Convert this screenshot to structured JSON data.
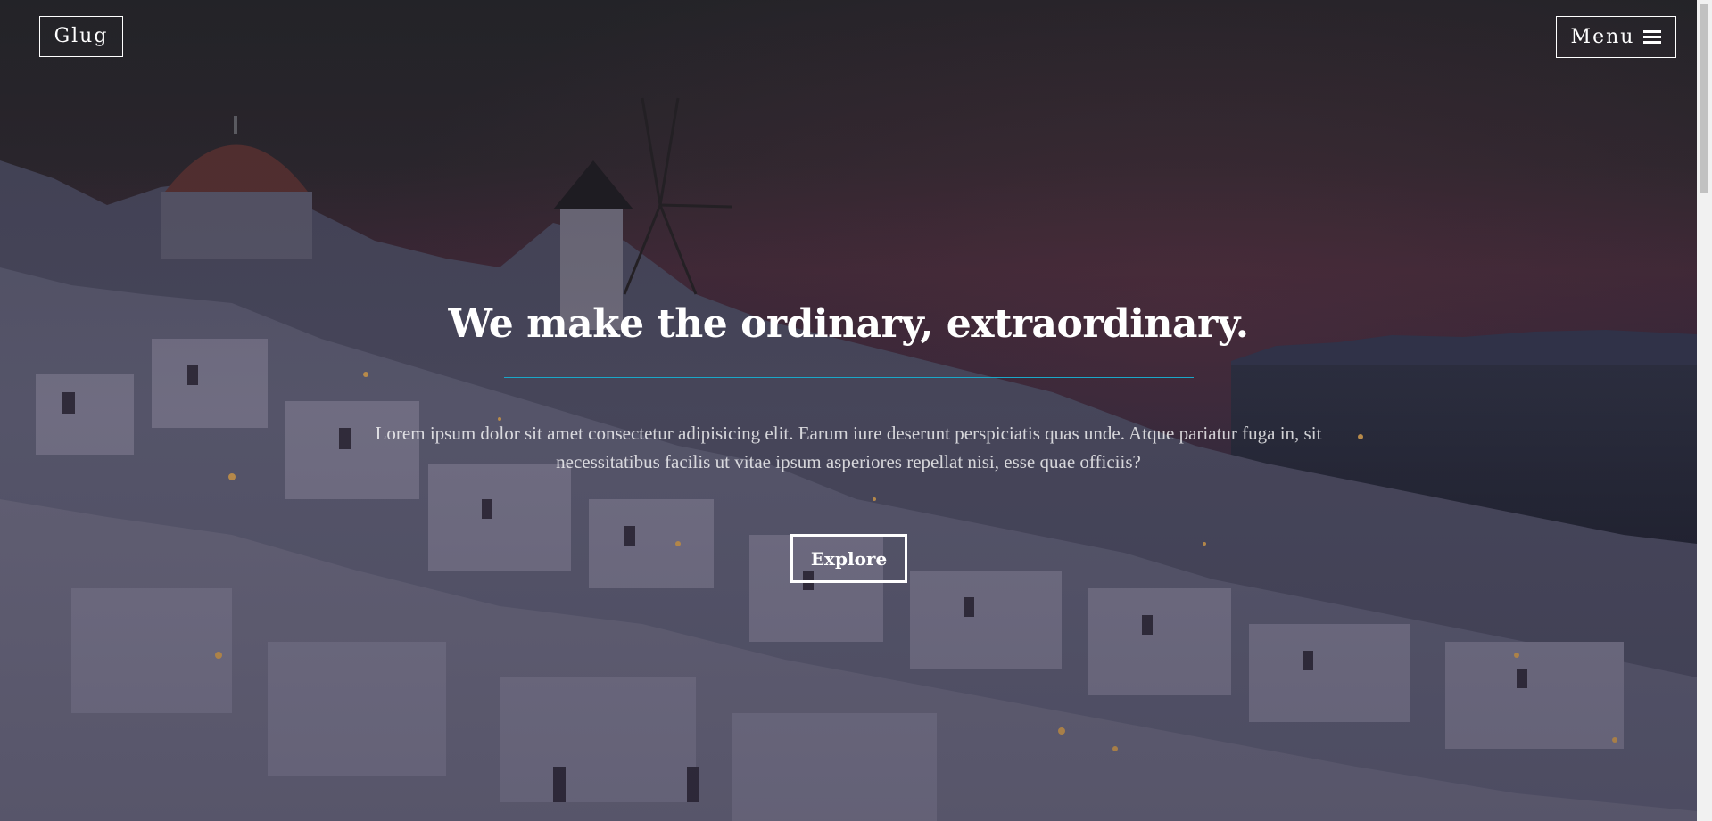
{
  "nav": {
    "brand": "Glug",
    "menu_label": "Menu",
    "menu_icon": "bars-icon"
  },
  "hero": {
    "headline": "We make the ordinary, extraordinary.",
    "lead": "Lorem ipsum dolor sit amet consectetur adipisicing elit. Earum iure deserunt perspiciatis quas unde. Atque pariatur fuga in, sit necessitatibus facilis ut vitae ipsum asperiores repellat nisi, esse quae officiis?",
    "cta_label": "Explore"
  },
  "colors": {
    "accent": "#1aa7c8",
    "text": "#ffffff"
  }
}
